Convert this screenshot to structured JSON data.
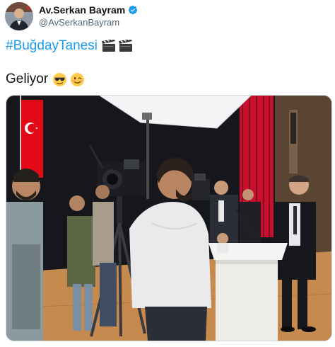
{
  "author": {
    "display_name": "Av.Serkan Bayram",
    "handle": "@AvSerkanBayram",
    "verified": true
  },
  "tweet": {
    "hashtag": "#BuğdayTanesi",
    "hashtag_emojis": [
      "clapper-board",
      "clapper-board"
    ],
    "text": "Geliyor",
    "text_emojis": [
      "sunglasses-face",
      "winking-face"
    ]
  },
  "media": {
    "description_icon": "photo",
    "scene": "film set with cameras, a lectern and a Turkish flag"
  },
  "colors": {
    "link": "#1d9bf0",
    "secondary_text": "#536471",
    "verified_badge": "#1d9bf0",
    "flag_red": "#e30a17",
    "curtain_red": "#c8102e",
    "stage_floor": "#c68a4e"
  }
}
